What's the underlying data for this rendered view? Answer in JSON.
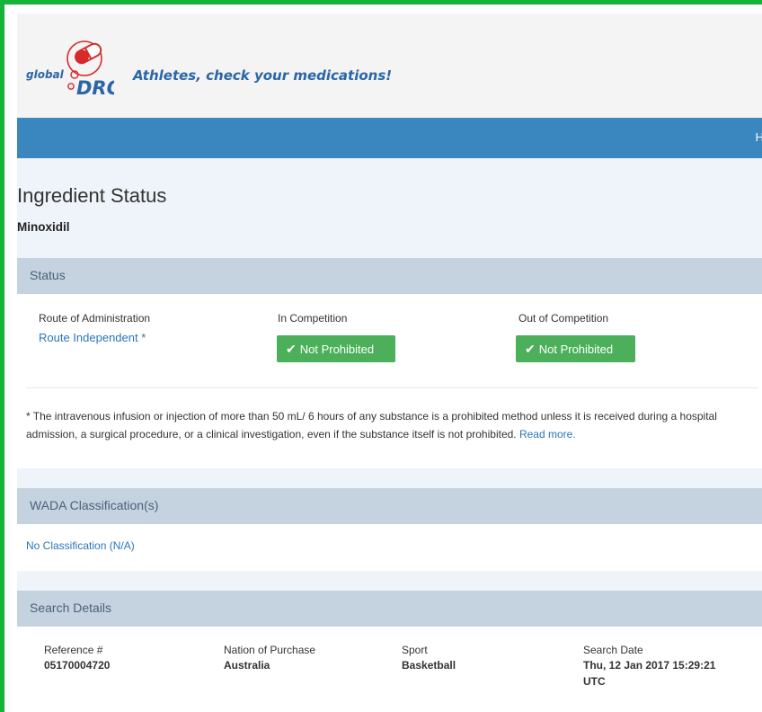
{
  "header": {
    "logo_text_small": "global",
    "logo_text_big": "DRO",
    "tagline": "Athletes, check your medications!"
  },
  "navbar": {
    "item_partial": "H"
  },
  "page": {
    "title": "Ingredient Status",
    "ingredient": "Minoxidil"
  },
  "status_panel": {
    "title": "Status",
    "route_label": "Route of Administration",
    "route_value": "Route Independent",
    "route_marker": "*",
    "in_competition_label": "In Competition",
    "in_competition_status": "Not Prohibited",
    "out_competition_label": "Out of Competition",
    "out_competition_status": "Not Prohibited",
    "footnote": "* The intravenous infusion or injection of more than 50 mL/ 6 hours of any substance is a prohibited method unless it is received during a hospital admission, a surgical procedure, or a clinical investigation, even if the substance itself is not prohibited.",
    "read_more": "Read more."
  },
  "classification_panel": {
    "title": "WADA Classification(s)",
    "value": "No Classification (N/A)"
  },
  "search_panel": {
    "title": "Search Details",
    "reference_label": "Reference #",
    "reference_value": "05170004720",
    "nation_label": "Nation of Purchase",
    "nation_value": "Australia",
    "sport_label": "Sport",
    "sport_value": "Basketball",
    "date_label": "Search Date",
    "date_value_line1": "Thu, 12 Jan 2017 15:29:21",
    "date_value_line2": "UTC"
  },
  "colors": {
    "frame_border": "#16b33a",
    "navbar": "#3a87bf",
    "panel_header": "#c5d3e1",
    "status_green": "#4cb05a",
    "link": "#2a76b9"
  }
}
